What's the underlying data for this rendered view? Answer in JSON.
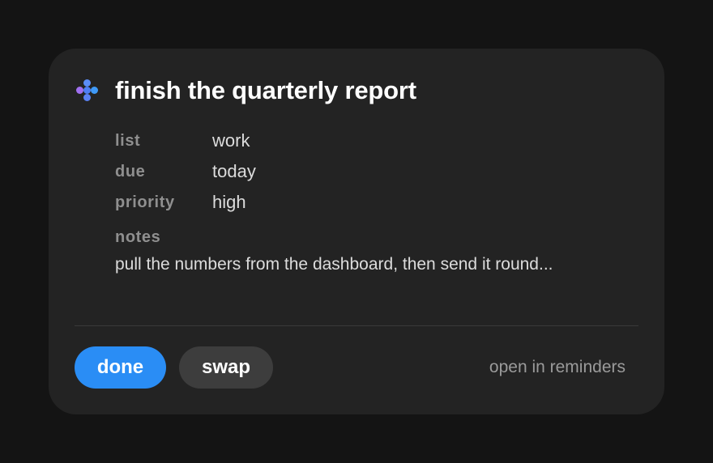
{
  "reminder": {
    "title": "finish the quarterly report",
    "app_icon": "reminders-dots-icon",
    "fields": [
      {
        "label": "list",
        "value": "work"
      },
      {
        "label": "due",
        "value": "today"
      },
      {
        "label": "priority",
        "value": "high"
      }
    ],
    "notes_label": "notes",
    "notes": "pull the numbers from the dashboard, then send it round..."
  },
  "actions": {
    "done_label": "done",
    "swap_label": "swap",
    "open_label": "open in reminders"
  },
  "colors": {
    "background": "#141414",
    "card": "#232323",
    "accent": "#2a8df5",
    "secondary_button": "#3d3d3d"
  }
}
